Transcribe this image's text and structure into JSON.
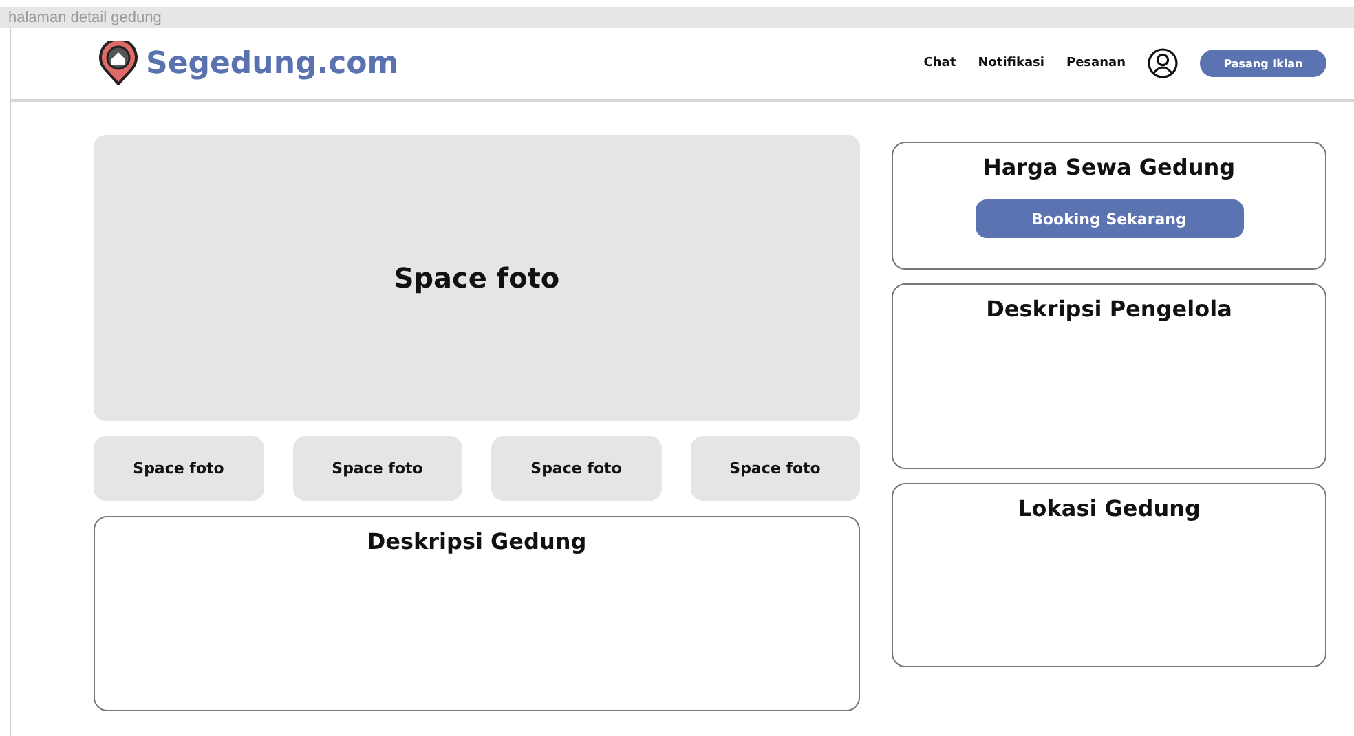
{
  "frame_title": "halaman detail gedung",
  "header": {
    "brand": "Segedung.com",
    "nav": [
      "Chat",
      "Notifikasi",
      "Pesanan"
    ],
    "cta": "Pasang Iklan"
  },
  "main_photo": {
    "label": "Space foto"
  },
  "thumbnails": [
    "Space foto",
    "Space foto",
    "Space foto",
    "Space foto"
  ],
  "description": {
    "title": "Deskripsi Gedung"
  },
  "sidebar": [
    {
      "kind": "price",
      "title": "Harga Sewa Gedung",
      "button": "Booking Sekarang"
    },
    {
      "kind": "info",
      "title": "Deskripsi Pengelola"
    },
    {
      "kind": "info",
      "title": "Lokasi Gedung"
    }
  ]
}
